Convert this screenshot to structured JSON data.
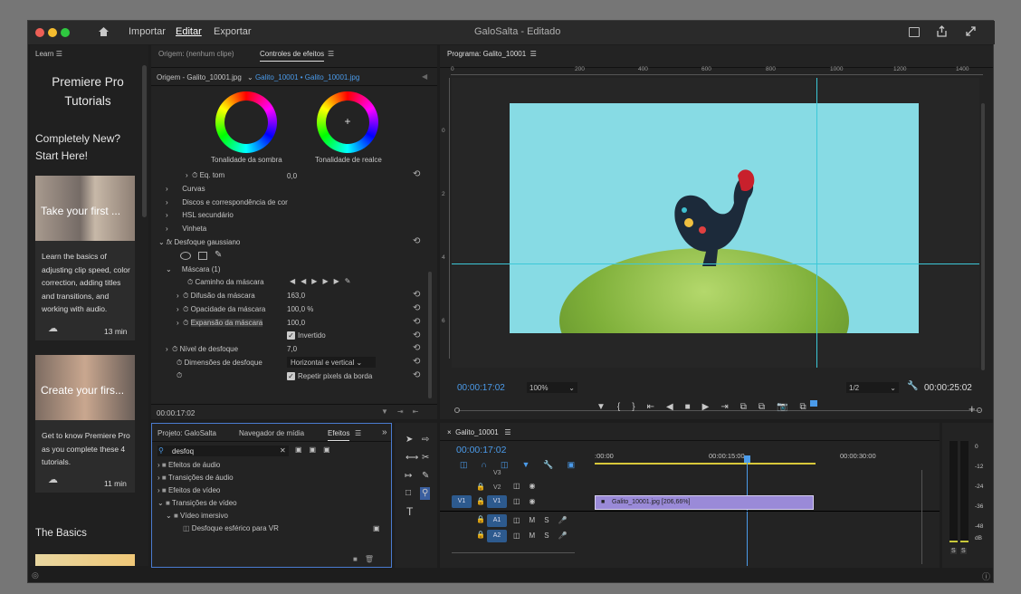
{
  "app": {
    "title": "GaloSalta - Editado",
    "tabs": [
      "Importar",
      "Editar",
      "Exportar"
    ],
    "active_tab": "Editar"
  },
  "learn": {
    "header": "Learn",
    "title": "Premiere Pro Tutorials",
    "section1": "Completely New? Start Here!",
    "card1": {
      "thumb_text": "Take your first ...",
      "desc": "Learn the basics of adjusting clip speed, color correction, adding titles and transitions, and working with audio.",
      "duration": "13 min"
    },
    "card2": {
      "thumb_text": "Create your firs...",
      "desc": "Get to know Premiere Pro as you complete these 4 tutorials.",
      "duration": "11 min"
    },
    "section2": "The Basics"
  },
  "effect_controls": {
    "tab_source": "Origem: (nenhum clipe)",
    "tab_active": "Controles de efeitos",
    "clip_source": "Origem - Galito_10001.jpg",
    "clip_seq": "Galito_10001 • Galito_10001.jpg",
    "wheel1": "Tonalidade da sombra",
    "wheel2": "Tonalidade de realce",
    "rows": [
      {
        "label": "Eq. tom",
        "value": "0,0"
      },
      {
        "label": "Curvas",
        "value": ""
      },
      {
        "label": "Discos e correspondência de cor",
        "value": ""
      },
      {
        "label": "HSL secundário",
        "value": ""
      },
      {
        "label": "Vinheta",
        "value": ""
      },
      {
        "label": "Desfoque gaussiano",
        "value": ""
      },
      {
        "label": "Máscara (1)",
        "value": ""
      },
      {
        "label": "Caminho da máscara",
        "value": ""
      },
      {
        "label": "Difusão da máscara",
        "value": "163,0"
      },
      {
        "label": "Opacidade da máscara",
        "value": "100,0 %"
      },
      {
        "label": "Expansão da máscara",
        "value": "100,0"
      },
      {
        "label": "Invertido",
        "value": ""
      },
      {
        "label": "Nível de desfoque",
        "value": "7,0"
      },
      {
        "label": "Dimensões de desfoque",
        "value": "Horizontal e vertical"
      },
      {
        "label": "Repetir pixels da borda",
        "value": ""
      }
    ],
    "timecode": "00:00:17:02"
  },
  "program": {
    "header": "Programa: Galito_10001",
    "ruler": [
      "0",
      "200",
      "400",
      "600",
      "800",
      "1000",
      "1200",
      "1400"
    ],
    "vruler": [
      "0",
      "2",
      "4",
      "6"
    ],
    "timecode": "00:00:17:02",
    "zoom": "100%",
    "quality": "1/2",
    "duration": "00:00:25:02"
  },
  "project": {
    "tabs": [
      "Projeto: GaloSalta",
      "Navegador de mídia",
      "Efeitos"
    ],
    "search": "desfoq",
    "tree": [
      "Efeitos de áudio",
      "Transições de áudio",
      "Efeitos de vídeo",
      "Transições de vídeo",
      "Vídeo imersivo",
      "Desfoque esférico para VR"
    ]
  },
  "timeline": {
    "header": "Galito_10001",
    "timecode": "00:00:17:02",
    "ruler": [
      ":00:00",
      "00:00:15:00",
      "00:00:30:00"
    ],
    "tracks": [
      {
        "name": "V3"
      },
      {
        "name": "V2"
      },
      {
        "name": "V1"
      },
      {
        "name": "A1"
      },
      {
        "name": "A2"
      }
    ],
    "clip": "Galito_10001.jpg [206,66%]",
    "src_patch": "V1"
  },
  "meter": {
    "scale": [
      "0",
      "-12",
      "-24",
      "-36",
      "-48",
      "dB"
    ],
    "solo": [
      "S",
      "S"
    ]
  }
}
